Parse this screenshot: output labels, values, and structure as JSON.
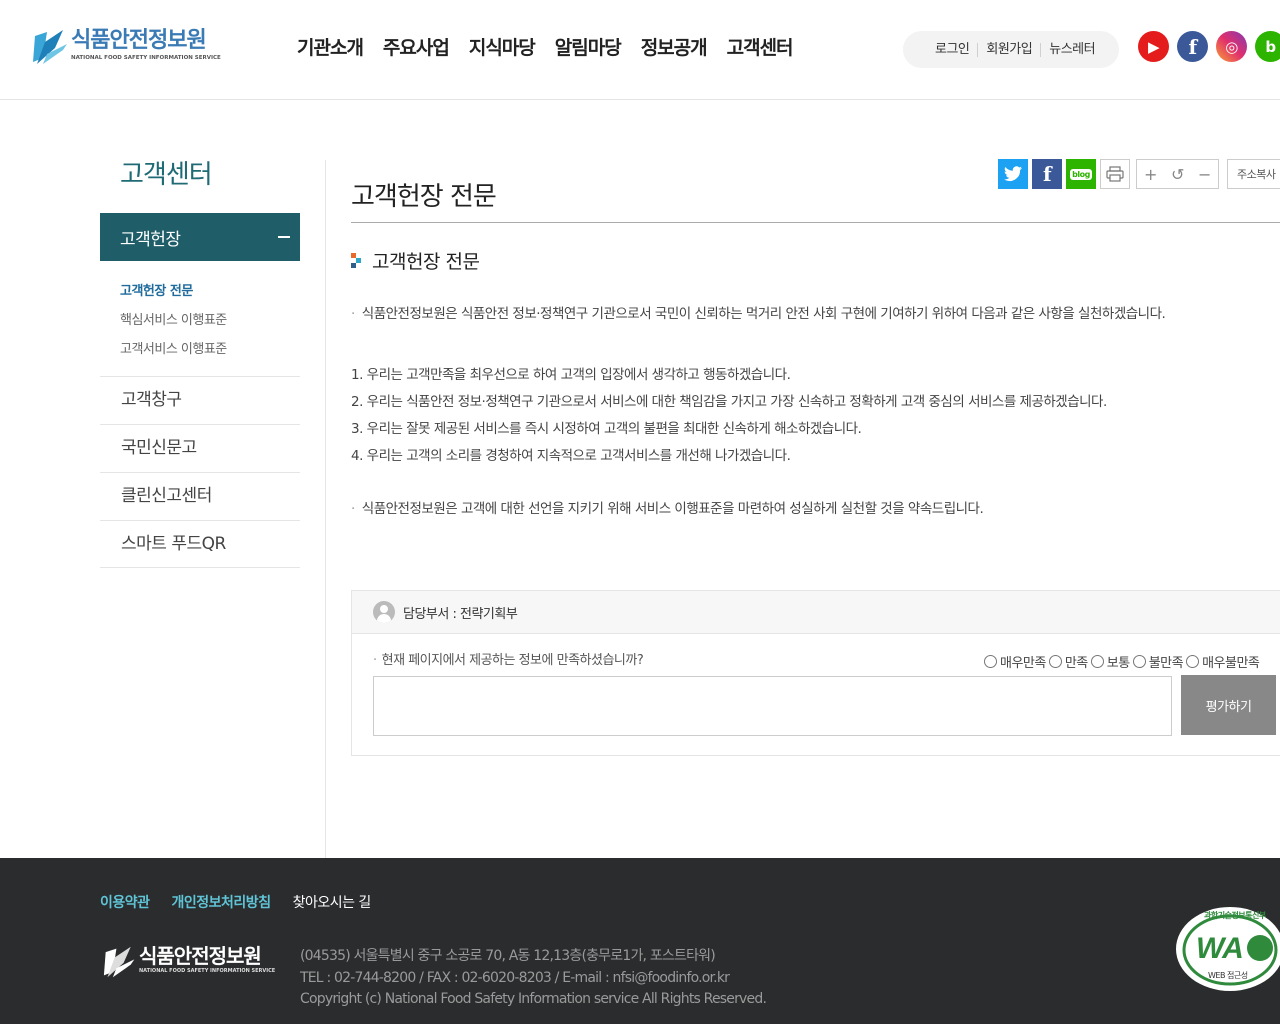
{
  "header": {
    "logo_ko": "식품안전정보원",
    "logo_en": "NATIONAL FOOD SAFETY INFORMATION SERVICE",
    "menu": [
      "기관소개",
      "주요사업",
      "지식마당",
      "알림마당",
      "정보공개",
      "고객센터"
    ],
    "util": [
      "로그인",
      "회원가입",
      "뉴스레터"
    ],
    "sns": [
      {
        "icon": "youtube-icon",
        "glyph": "▶"
      },
      {
        "icon": "facebook-icon",
        "glyph": "f"
      },
      {
        "icon": "instagram-icon",
        "glyph": "◎"
      },
      {
        "icon": "band-icon",
        "glyph": "b"
      }
    ]
  },
  "lnb": {
    "title": "고객센터",
    "active": "고객헌장",
    "sub": [
      "고객헌장 전문",
      "핵심서비스 이행표준",
      "고객서비스 이행표준"
    ],
    "items": [
      "고객창구",
      "국민신문고",
      "클린신고센터",
      "스마트 푸드QR"
    ]
  },
  "tools": {
    "blog": "blog",
    "zoom_in": "+",
    "reset": "↺",
    "zoom_out": "−",
    "copy": "주소복사"
  },
  "content": {
    "page_title": "고객헌장 전문",
    "section_title": "고객헌장 전문",
    "intro": "식품안전정보원은 식품안전 정보·정책연구 기관으로서 국민이 신뢰하는 먹거리 안전 사회 구현에 기여하기 위하여 다음과 같은 사항을 실천하겠습니다.",
    "items": [
      "1. 우리는 고객만족을 최우선으로 하여 고객의 입장에서 생각하고 행동하겠습니다.",
      "2. 우리는 식품안전 정보·정책연구 기관으로서 서비스에 대한 책임감을 가지고 가장 신속하고 정확하게 고객 중심의 서비스를 제공하겠습니다.",
      "3. 우리는 잘못 제공된 서비스를 즉시 시정하여 고객의 불편을 최대한 신속하게 해소하겠습니다.",
      "4. 우리는 고객의 소리를 경청하여 지속적으로 고객서비스를 개선해 나가겠습니다."
    ],
    "closing": "식품안전정보원은 고객에 대한 선언을 지키기 위해 서비스 이행표준을 마련하여 성실하게 실천할 것을 약속드립니다."
  },
  "survey": {
    "dept": "담당부서 : 전략기획부",
    "question": "현재 페이지에서 제공하는 정보에 만족하셨습니까?",
    "options": [
      "매우만족",
      "만족",
      "보통",
      "불만족",
      "매우불만족"
    ],
    "button": "평가하기"
  },
  "footer": {
    "links": [
      "이용약관",
      "개인정보처리방침",
      "찾아오시는 길"
    ],
    "logo_ko": "식품안전정보원",
    "logo_en": "NATIONAL FOOD SAFETY INFORMATION SERVICE",
    "address": "(04535) 서울특별시 중구 소공로 70, A동 12,13층(충무로1가, 포스트타워)",
    "contact": "TEL : 02-744-8200 / FAX : 02-6020-8203 / E-mail : nfsi@foodinfo.or.kr",
    "copyright": "Copyright (c) National Food Safety Information service All Rights Reserved.",
    "wa_text": "WA",
    "wa_arc": "과학기술정보통신부",
    "wa_sub": "WEB 접근성"
  },
  "colors": {
    "accent": "#1f5e68",
    "link_blue": "#1f6b9c",
    "footer_bg": "#2a2c2e"
  }
}
